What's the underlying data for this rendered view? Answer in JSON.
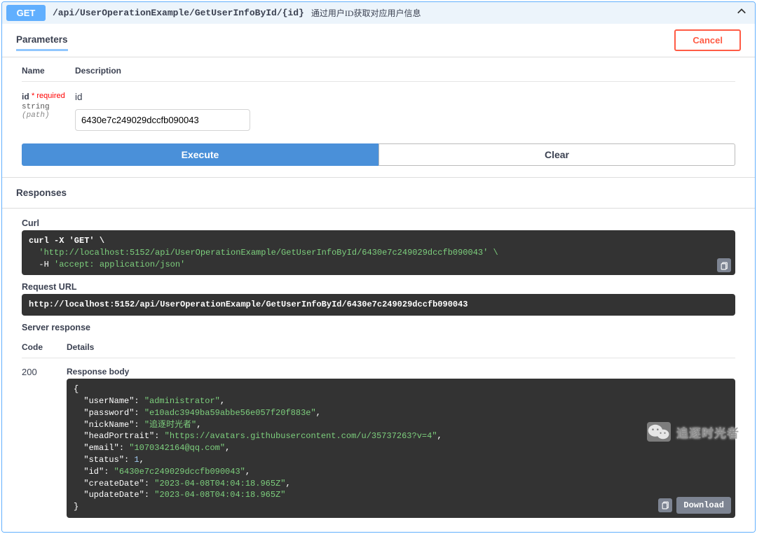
{
  "operation": {
    "method": "GET",
    "path": "/api/UserOperationExample/GetUserInfoById/{id}",
    "summary": "通过用户ID获取对应用户信息"
  },
  "tabs": {
    "parameters_label": "Parameters",
    "cancel_label": "Cancel"
  },
  "param_headers": {
    "name": "Name",
    "description": "Description"
  },
  "param": {
    "name": "id",
    "required_label": "* required",
    "type": "string",
    "in": "(path)",
    "desc": "id",
    "value": "6430e7c249029dccfb090043"
  },
  "buttons": {
    "execute": "Execute",
    "clear": "Clear"
  },
  "responses": {
    "heading": "Responses",
    "curl_label": "Curl",
    "curl_cmd": "curl -X 'GET' \\",
    "curl_url": "  'http://localhost:5152/api/UserOperationExample/GetUserInfoById/6430e7c249029dccfb090043' \\",
    "curl_h_pre": "  -H ",
    "curl_h_val": "'accept: application/json'",
    "request_url_label": "Request URL",
    "request_url": "http://localhost:5152/api/UserOperationExample/GetUserInfoById/6430e7c249029dccfb090043",
    "server_response_label": "Server response",
    "code_header": "Code",
    "details_header": "Details",
    "code": "200",
    "response_body_label": "Response body",
    "json": {
      "userName": "administrator",
      "password": "e10adc3949ba59abbe56e057f20f883e",
      "nickName": "追逐时光者",
      "headPortrait": "https://avatars.githubusercontent.com/u/35737263?v=4",
      "email": "1070342164@qq.com",
      "status": 1,
      "id": "6430e7c249029dccfb090043",
      "createDate": "2023-04-08T04:04:18.965Z",
      "updateDate": "2023-04-08T04:04:18.965Z"
    },
    "download_label": "Download"
  },
  "watermark": "追逐时光者"
}
